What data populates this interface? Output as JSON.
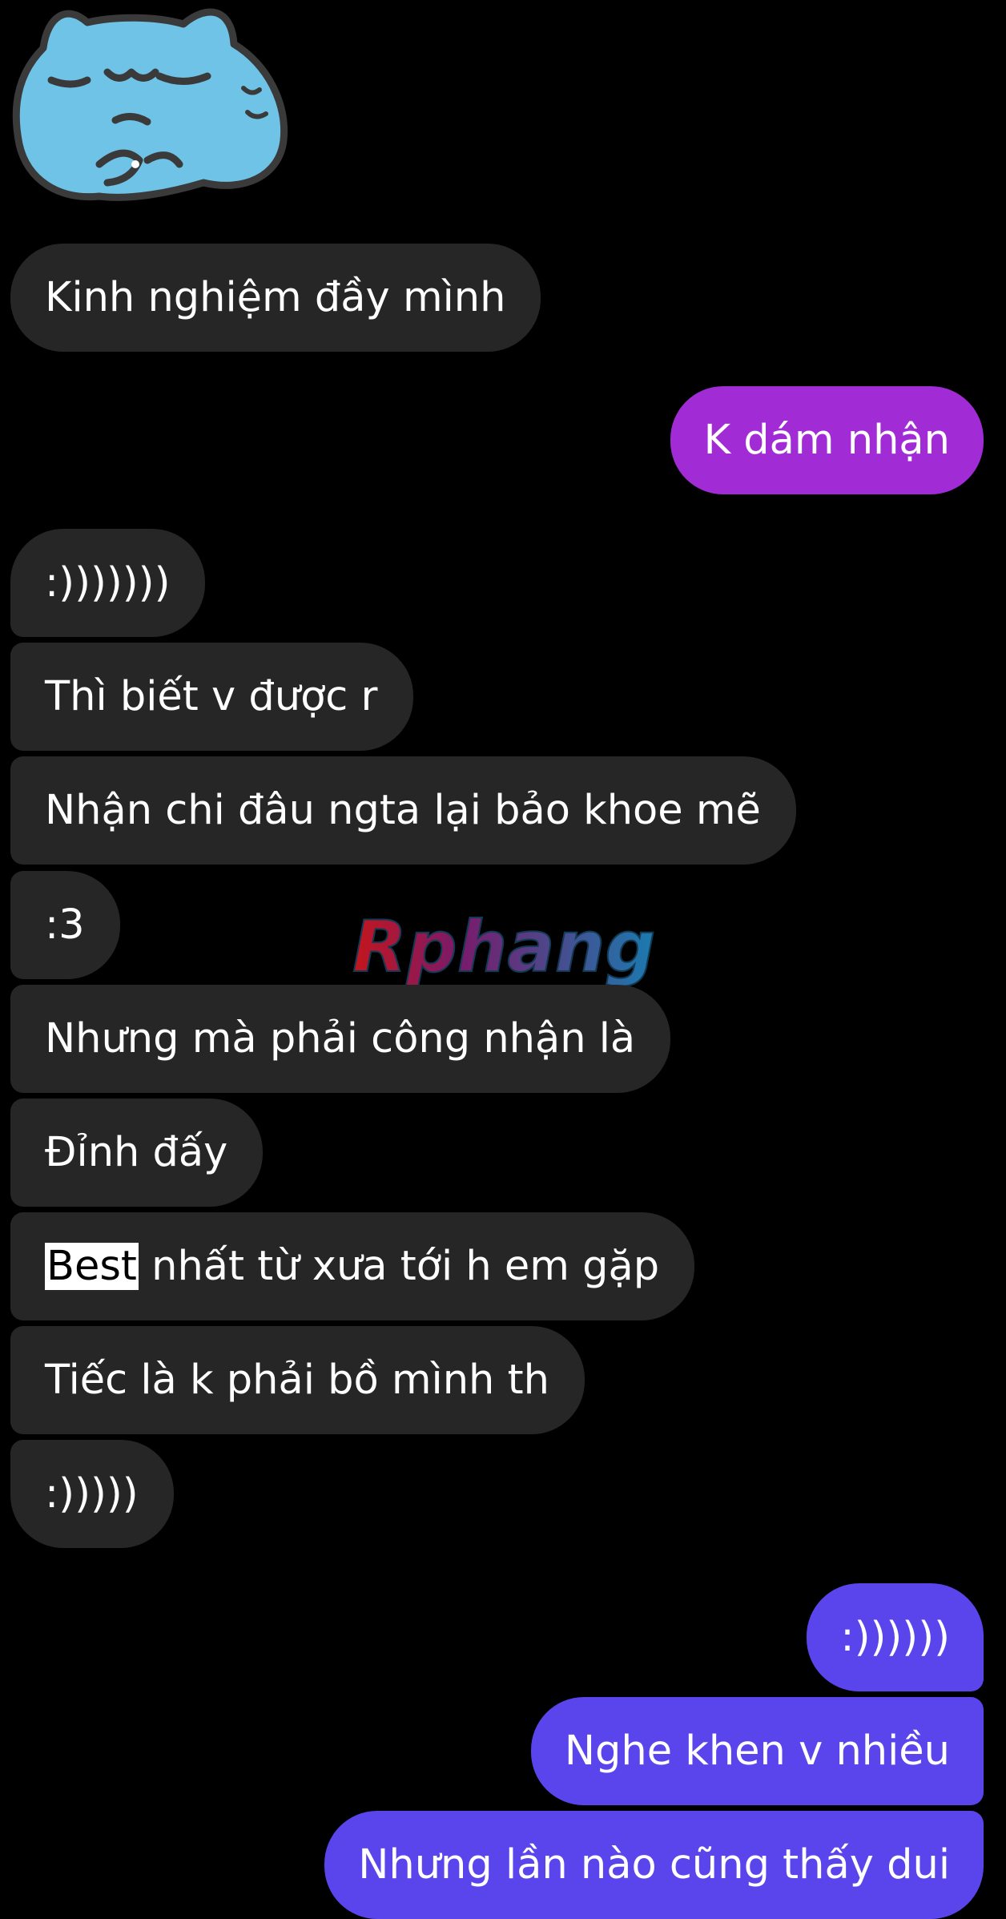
{
  "sticker": {
    "name": "sleeping-blue-cat-sticker"
  },
  "watermark": {
    "text": "Rphang",
    "colors": [
      "#c4161c",
      "#1a7bb0"
    ]
  },
  "colors": {
    "incoming_bubble": "#262626",
    "outgoing_purple": "#a12cd6",
    "outgoing_violet": "#5a45ec",
    "background": "#000000",
    "text": "#ffffff"
  },
  "messages": [
    {
      "id": "m1",
      "direction": "incoming",
      "text": "Kinh nghiệm đầy mình"
    },
    {
      "id": "m2",
      "direction": "outgoing",
      "text": "K dám nhận"
    },
    {
      "id": "m3",
      "direction": "incoming",
      "text": ":)))))))"
    },
    {
      "id": "m4",
      "direction": "incoming",
      "text": "Thì biết v được r"
    },
    {
      "id": "m5",
      "direction": "incoming",
      "text": "Nhận chi đâu ngta lại bảo khoe mẽ"
    },
    {
      "id": "m6",
      "direction": "incoming",
      "text": ":3"
    },
    {
      "id": "m7",
      "direction": "incoming",
      "text": "Nhưng mà phải công nhận là"
    },
    {
      "id": "m8",
      "direction": "incoming",
      "text": "Đỉnh đấy"
    },
    {
      "id": "m9",
      "direction": "incoming",
      "highlight": "Best",
      "text": " nhất từ xưa tới h em gặp"
    },
    {
      "id": "m10",
      "direction": "incoming",
      "text": "Tiếc là k phải bồ mình th"
    },
    {
      "id": "m11",
      "direction": "incoming",
      "text": ":)))))"
    },
    {
      "id": "m12",
      "direction": "outgoing",
      "text": ":))))))"
    },
    {
      "id": "m13",
      "direction": "outgoing",
      "text": "Nghe khen v nhiều"
    },
    {
      "id": "m14",
      "direction": "outgoing",
      "text": "Nhưng lần nào cũng thấy dui"
    }
  ]
}
